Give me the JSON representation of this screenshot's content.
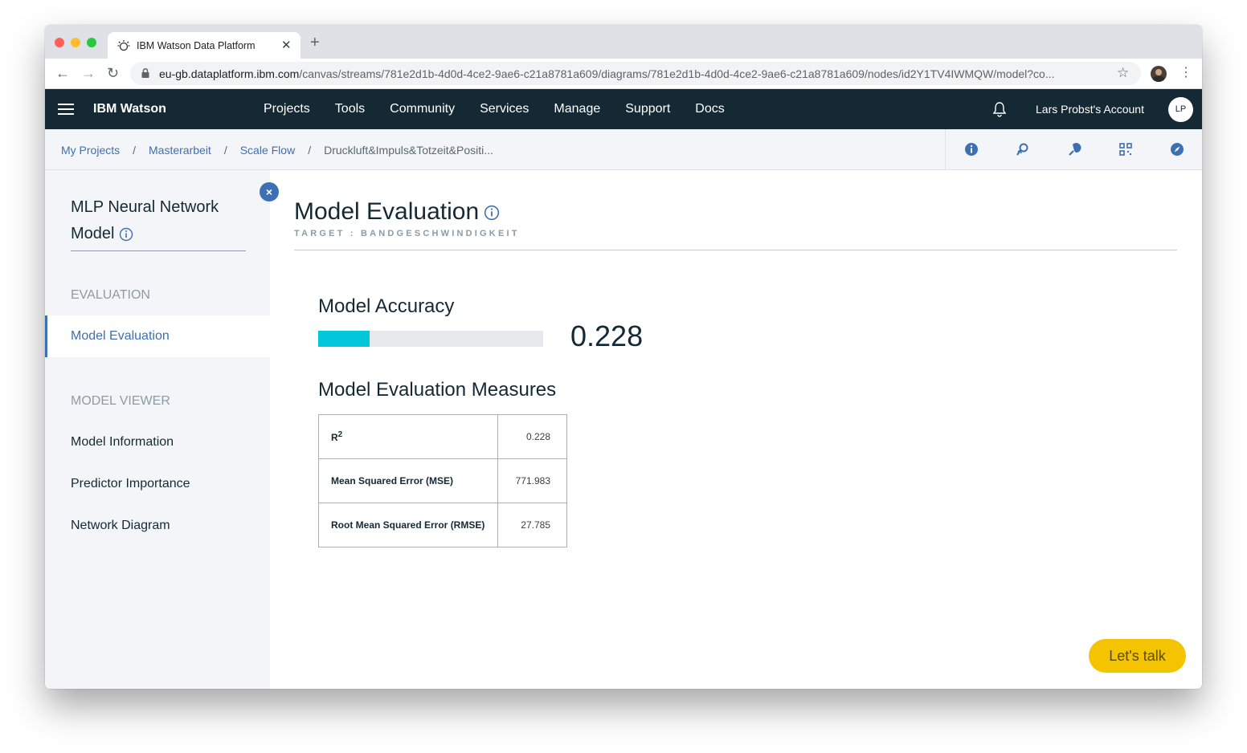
{
  "browser": {
    "tab_title": "IBM Watson Data Platform",
    "url_host": "eu-gb.dataplatform.ibm.com",
    "url_path": "/canvas/streams/781e2d1b-4d0d-4ce2-9ae6-c21a8781a609/diagrams/781e2d1b-4d0d-4ce2-9ae6-c21a8781a609/nodes/id2Y1TV4IWMQW/model?co..."
  },
  "header": {
    "brand": "IBM Watson",
    "nav": [
      "Projects",
      "Tools",
      "Community",
      "Services",
      "Manage",
      "Support",
      "Docs"
    ],
    "account": "Lars Probst's Account",
    "avatar_initials": "LP"
  },
  "breadcrumb": {
    "items": [
      "My Projects",
      "Masterarbeit",
      "Scale Flow"
    ],
    "current": "Druckluft&Impuls&Totzeit&Positi...",
    "separator": "/"
  },
  "toolbar_icons": [
    "info-icon",
    "refresh-icon",
    "brush-icon",
    "qr-icon",
    "compass-icon"
  ],
  "sidebar": {
    "title": "MLP Neural Network Model",
    "sections": [
      {
        "heading": "EVALUATION",
        "items": [
          "Model Evaluation"
        ]
      },
      {
        "heading": "MODEL VIEWER",
        "items": [
          "Model Information",
          "Predictor Importance",
          "Network Diagram"
        ]
      }
    ],
    "close_label": "×"
  },
  "main": {
    "title": "Model Evaluation",
    "subtitle": "TARGET : BANDGESCHWINDIGKEIT",
    "accuracy_label": "Model Accuracy",
    "accuracy_value": "0.228",
    "accuracy_fraction": 0.228,
    "measures_label": "Model Evaluation Measures",
    "measures": [
      {
        "name": "R",
        "sup": "2",
        "value": "0.228"
      },
      {
        "name": "Mean Squared Error (MSE)",
        "sup": "",
        "value": "771.983"
      },
      {
        "name": "Root Mean Squared Error (RMSE)",
        "sup": "",
        "value": "27.785"
      }
    ]
  },
  "chat_button": "Let's talk",
  "colors": {
    "header_bg": "#152935",
    "accent": "#3d70b2",
    "bar": "#00c7d9",
    "chat": "#f5c400"
  }
}
